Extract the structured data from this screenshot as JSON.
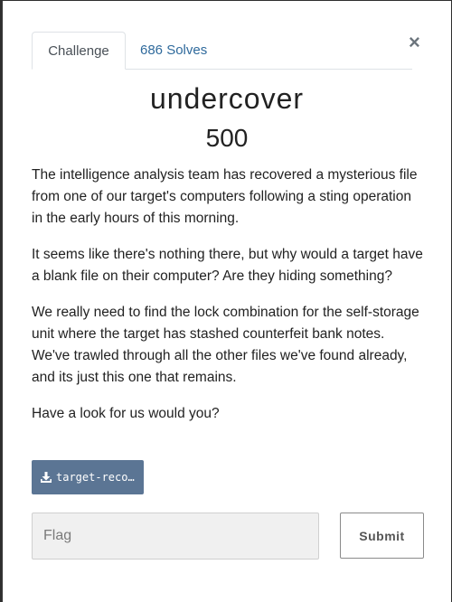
{
  "tabs": [
    {
      "label": "Challenge",
      "active": true
    },
    {
      "label": "686 Solves",
      "active": false
    }
  ],
  "close_label": "×",
  "challenge": {
    "name": "undercover",
    "value": "500",
    "description": [
      "The intelligence analysis team has recovered a mysterious file from one of our target's computers following a sting operation in the early hours of this morning.",
      "It seems like there's nothing there, but why would a target have a blank file on their computer? Are they hiding something?",
      "We really need to find the lock combination for the self-storage unit where the target has stashed counterfeit bank notes. We've trawled through all the other files we've found already, and its just this one that remains.",
      "Have a look for us would you?"
    ],
    "file_label": "target-recov...",
    "file_icon": "download-icon"
  },
  "form": {
    "flag_placeholder": "Flag",
    "flag_value": "",
    "submit_label": "Submit"
  },
  "colors": {
    "link": "#2f6a9c",
    "file_button": "#5b7594"
  }
}
